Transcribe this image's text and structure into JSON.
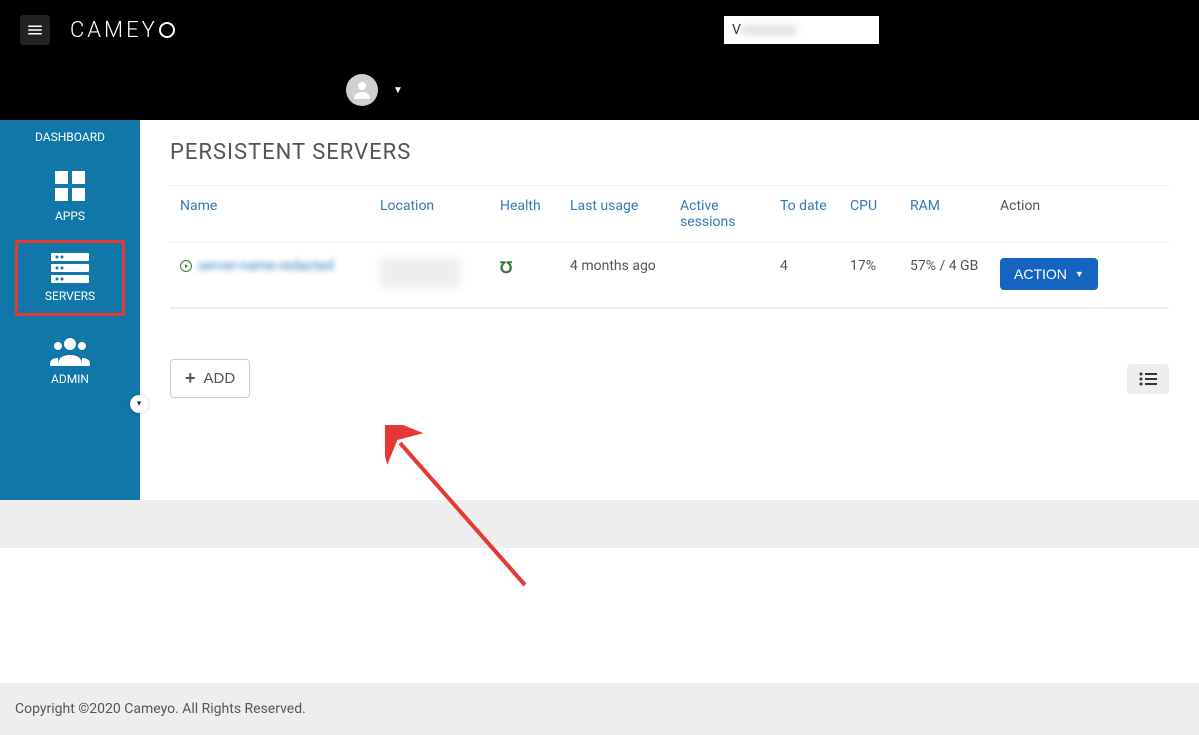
{
  "header": {
    "logo_text": "CAMEYO",
    "search_prefix": "V"
  },
  "sidebar": {
    "items": [
      {
        "label": "DASHBOARD"
      },
      {
        "label": "APPS"
      },
      {
        "label": "SERVERS"
      },
      {
        "label": "ADMIN"
      }
    ]
  },
  "page": {
    "title": "PERSISTENT SERVERS",
    "columns": {
      "name": "Name",
      "location": "Location",
      "health": "Health",
      "last_usage": "Last usage",
      "active_sessions": "Active sessions",
      "to_date": "To date",
      "cpu": "CPU",
      "ram": "RAM",
      "action": "Action"
    },
    "rows": [
      {
        "name": "server-name-redacted",
        "location": "",
        "health": "ok",
        "last_usage": "4 months ago",
        "active_sessions": "",
        "to_date": "4",
        "cpu": "17%",
        "ram": "57% / 4 GB",
        "action_label": "ACTION"
      }
    ],
    "add_button": "ADD"
  },
  "footer": {
    "copyright": "Copyright ©2020 Cameyo. All Rights Reserved."
  }
}
